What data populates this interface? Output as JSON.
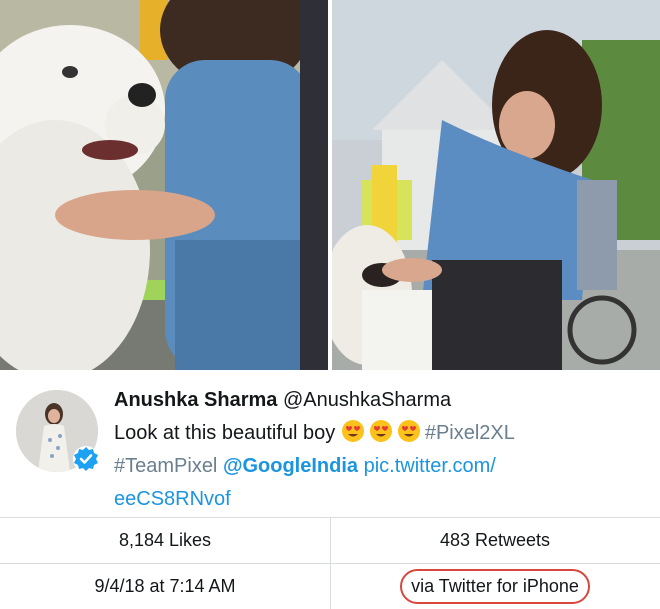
{
  "tweet": {
    "name": "Anushka Sharma",
    "handle": "@AnushkaSharma",
    "text_prefix": "Look at this beautiful boy",
    "hashtag1": "#Pixel2XL",
    "hashtag2": "#TeamPixel",
    "mention": "@GoogleIndia",
    "link_line1": "pic.twitter.com/",
    "link_line2": "eeCS8RNvof"
  },
  "stats": {
    "likes": "8,184 Likes",
    "retweets": "483 Retweets",
    "datetime": "9/4/18 at 7:14 AM",
    "source": "via Twitter for iPhone"
  },
  "colors": {
    "link": "#1b95e0",
    "hashtag": "#6a7f8f",
    "highlight": "#d9463c",
    "verified": "#1da1f2"
  },
  "icons": [
    "heart-eyes-emoji",
    "verified-badge-icon"
  ]
}
